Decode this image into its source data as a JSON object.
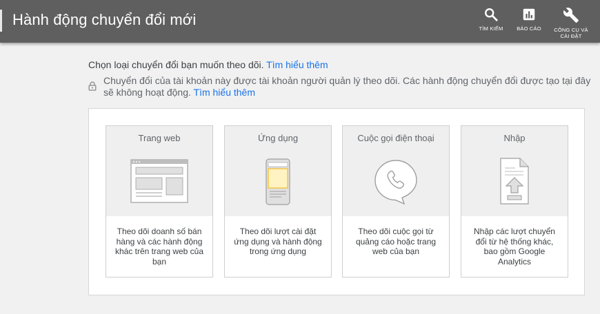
{
  "header": {
    "title": "Hành động chuyển đổi mới",
    "buttons": {
      "search": {
        "label": "TÌM KIẾM",
        "icon": "search-icon"
      },
      "reports": {
        "label": "BÁO CÁO",
        "icon": "bar-chart-icon"
      },
      "tools_line1": "CÔNG CỤ VÀ",
      "tools_line2": "CÀI ĐẶT",
      "tools_icon": "wrench-icon"
    }
  },
  "intro": {
    "text": "Chọn loại chuyển đổi bạn muốn theo dõi.",
    "link": "Tìm hiểu thêm"
  },
  "notice": {
    "icon": "lock-icon",
    "text": "Chuyển đổi của tài khoản này được tài khoản người quản lý theo dõi. Các hành động chuyển đổi được tạo tại đây sẽ không hoạt động.",
    "link": "Tìm hiểu thêm"
  },
  "cards": [
    {
      "title": "Trang web",
      "icon": "webpage-icon",
      "description": "Theo dõi doanh số bán hàng và các hành động khác trên trang web của bạn"
    },
    {
      "title": "Ứng dụng",
      "icon": "mobile-app-icon",
      "description": "Theo dõi lượt cài đặt ứng dụng và hành động trong ứng dụng"
    },
    {
      "title": "Cuộc gọi điện thoại",
      "icon": "phone-call-icon",
      "description": "Theo dõi cuộc gọi từ quảng cáo hoặc trang web của bạn"
    },
    {
      "title": "Nhập",
      "icon": "file-upload-icon",
      "description": "Nhập các lượt chuyển đổi từ hệ thống khác, bao gồm Google Analytics"
    }
  ],
  "colors": {
    "header_bg": "#5f5f5f",
    "link": "#1a73e8",
    "page_bg": "#f1f1f1"
  }
}
